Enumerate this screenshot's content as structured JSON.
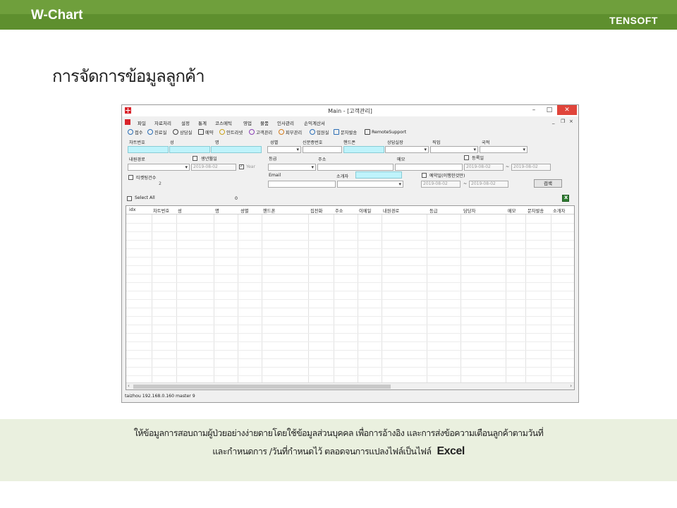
{
  "header": {
    "brand": "W-Chart",
    "company": "TENSOFT",
    "page_title": "การจัดการข้อมูลลูกค้า"
  },
  "window": {
    "title": "Main - [고객관리]",
    "controls": {
      "min": "–",
      "max": "□",
      "close": "✕"
    },
    "mdi_controls": {
      "min": "_",
      "restore": "❐",
      "close": "×"
    },
    "menu": [
      "파일",
      "자료처리",
      "설정",
      "통계",
      "코스메틱",
      "영업",
      "물품",
      "인사관리",
      "손익계산서"
    ],
    "toolbar": [
      "접수",
      "진료실",
      "상담실",
      "예약",
      "인트라넷",
      "고객관리",
      "피부관리",
      "입원실",
      "문자발송",
      "RemoteSupport"
    ],
    "form": {
      "chart_no": "차트번호",
      "last_name": "성",
      "first_name": "명",
      "gender": "성별",
      "id_number": "신분증번호",
      "mobile": "핸드폰",
      "counselor": "상담실장",
      "job": "직업",
      "nationality": "국적",
      "visit_route": "내원경로",
      "birth_month": "생년월일",
      "birth_date_value": "2019-08-02",
      "year_label": "Year",
      "grade": "등급",
      "address": "주소",
      "memo": "메모",
      "reg_date": "등록일",
      "reg_from": "2019-08-02",
      "reg_to": "2019-08-02",
      "tilde": "~",
      "ticketing": "티켓팅건수",
      "ticketing_count": "2",
      "email": "Email",
      "referrer": "소개자",
      "reservation_date": "예약일(이행한것만)",
      "res_from": "2019-08-02",
      "res_to": "2019-08-02",
      "search_button": "검색",
      "select_all": "Select All",
      "count": "0"
    },
    "grid_headers": [
      "idx",
      "차트번호",
      "성",
      "명",
      "성별",
      "핸드폰",
      "집전화",
      "주소",
      "이메일",
      "내원경로",
      "등급",
      "담당자",
      "메모",
      "문자발송",
      "소개자"
    ],
    "status": "taizhou  192.168.0.160  master  9"
  },
  "caption": {
    "line1": "ให้ข้อมูลการสอบถามผู้ป่วยอย่างง่ายดายโดยใช้ข้อมูลส่วนบุคคล  เพื่อการอ้างอิง  และการส่งข้อความเตือนลูกค้าตามวันที่",
    "line2": "และกำหนดการ /วันที่กำหนดไว้  ตลอดจนการแปลงไฟล์เป็นไฟล์",
    "excel": "Excel"
  }
}
